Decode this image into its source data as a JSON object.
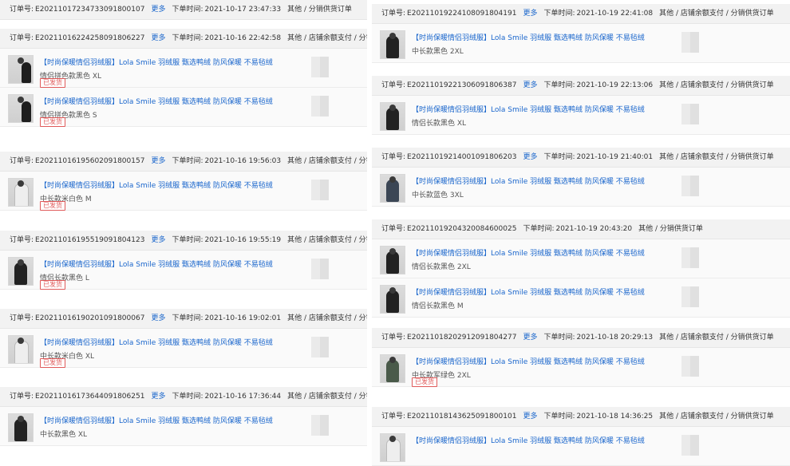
{
  "common": {
    "order_no_label": "订单号:",
    "time_label": "下单时间:",
    "more_label": "更多",
    "product_title": "【时尚保暖情侣羽绒服】Lola Smile 羽绒服 甄选鸭绒 防风保暖 不易毡绒",
    "order_type": "其他 / 店铺余额支付 / 分销供货订单",
    "order_type_short": "其他 / 分销供货订单",
    "shipped_badge": "已发货"
  },
  "left_orders": [
    {
      "order_no": "E20211017234733091800107",
      "time": "2021-10-17 23:47:33",
      "type_short": true,
      "items": []
    },
    {
      "order_no": "E20211016224258091806227",
      "time": "2021-10-16 22:42:58",
      "items": [
        {
          "spec": "情侣拼色款黑色 XL",
          "shipped": true,
          "thumb": "couple"
        },
        {
          "spec": "情侣拼色款黑色 S",
          "shipped": true,
          "thumb": "couple"
        }
      ]
    },
    {
      "order_no": "E20211016195602091800157",
      "time": "2021-10-16 19:56:03",
      "items": [
        {
          "spec": "中长款米白色 M",
          "shipped": true,
          "thumb": "white"
        }
      ]
    },
    {
      "order_no": "E20211016195519091804123",
      "time": "2021-10-16 19:55:19",
      "items": [
        {
          "spec": "情侣长款黑色 L",
          "shipped": true,
          "thumb": "dark"
        }
      ]
    },
    {
      "order_no": "E20211016190201091800067",
      "time": "2021-10-16 19:02:01",
      "items": [
        {
          "spec": "中长款米白色 XL",
          "shipped": true,
          "thumb": "white"
        }
      ]
    },
    {
      "order_no": "E20211016173644091806251",
      "time": "2021-10-16 17:36:44",
      "items": [
        {
          "spec": "中长款黑色 XL",
          "shipped": false,
          "thumb": "dark"
        }
      ]
    }
  ],
  "right_orders": [
    {
      "order_no": "E20211019224108091804191",
      "time": "2021-10-19 22:41:08",
      "items": [
        {
          "spec": "中长款黑色 2XL",
          "shipped": false,
          "thumb": "dark"
        }
      ]
    },
    {
      "order_no": "E20211019221306091806387",
      "time": "2021-10-19 22:13:06",
      "items": [
        {
          "spec": "情侣长款黑色 XL",
          "shipped": false,
          "thumb": "dark"
        }
      ]
    },
    {
      "order_no": "E20211019214001091806203",
      "time": "2021-10-19 21:40:01",
      "items": [
        {
          "spec": "中长款蓝色 3XL",
          "shipped": false,
          "thumb": "blue"
        }
      ]
    },
    {
      "order_no": "E20211019204320084600025",
      "time": "2021-10-19 20:43:20",
      "type_short": true,
      "no_more": true,
      "items": [
        {
          "spec": "情侣长款黑色 2XL",
          "shipped": false,
          "thumb": "dark"
        },
        {
          "spec": "情侣长款黑色 M",
          "shipped": false,
          "thumb": "dark"
        }
      ]
    },
    {
      "order_no": "E20211018202912091804277",
      "time": "2021-10-18 20:29:13",
      "items": [
        {
          "spec": "中长款军绿色 2XL",
          "shipped": true,
          "thumb": "green"
        }
      ]
    },
    {
      "order_no": "E20211018143625091800101",
      "time": "2021-10-18 14:36:25",
      "items": [
        {
          "spec": "",
          "shipped": false,
          "thumb": "white"
        }
      ]
    }
  ]
}
